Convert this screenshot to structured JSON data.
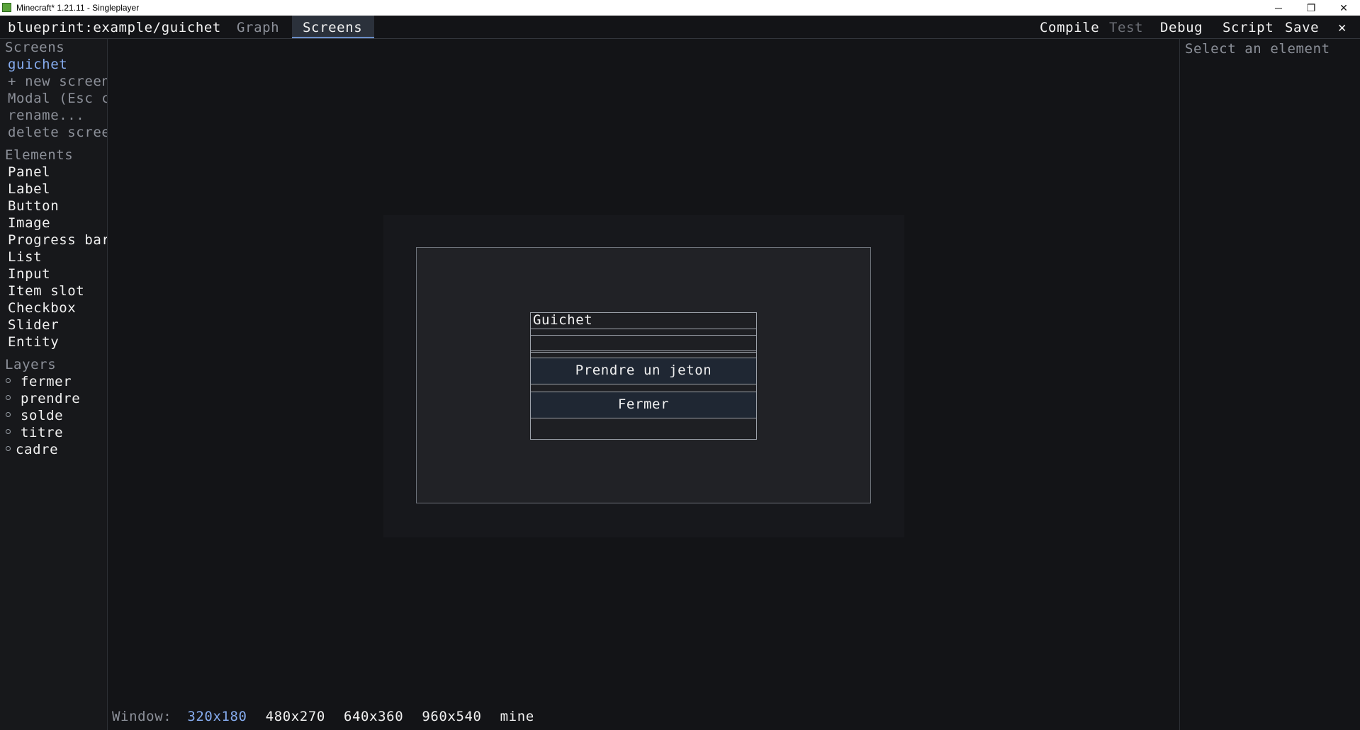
{
  "window": {
    "title": "Minecraft* 1.21.11 - Singleplayer",
    "minimize_glyph": "─",
    "restore_glyph": "❐",
    "close_glyph": "✕"
  },
  "topbar": {
    "path": "blueprint:example/guichet",
    "tabs": [
      {
        "label": "Graph",
        "active": false
      },
      {
        "label": "Screens",
        "active": true
      }
    ],
    "actions": {
      "compile": "Compile",
      "test": "Test",
      "debug": "Debug",
      "script": "Script",
      "save": "Save",
      "close": "✕"
    }
  },
  "sidebar": {
    "screens_header": "Screens",
    "screens": [
      "guichet"
    ],
    "new_screen": "+ new screen",
    "modal": "Modal (Esc closes)",
    "rename": "rename...",
    "delete": "delete screen",
    "elements_header": "Elements",
    "elements": [
      "Panel",
      "Label",
      "Button",
      "Image",
      "Progress bar",
      "List",
      "Input",
      "Item slot",
      "Checkbox",
      "Slider",
      "Entity"
    ],
    "layers_header": "Layers",
    "layers": [
      "fermer",
      "prendre",
      "solde",
      "titre",
      "cadre"
    ]
  },
  "inspector": {
    "placeholder": "Select an element"
  },
  "canvas": {
    "title_label": "Guichet",
    "buttons": [
      "Prendre un jeton",
      "Fermer"
    ]
  },
  "bottom": {
    "window_label": "Window:",
    "sizes": [
      "320x180",
      "480x270",
      "640x360",
      "960x540",
      "mine"
    ],
    "selected_size": "320x180"
  },
  "colors": {
    "accent": "#86acef",
    "background": "#131417",
    "sidebar": "#17181b",
    "button_fill": "#1f2733"
  }
}
